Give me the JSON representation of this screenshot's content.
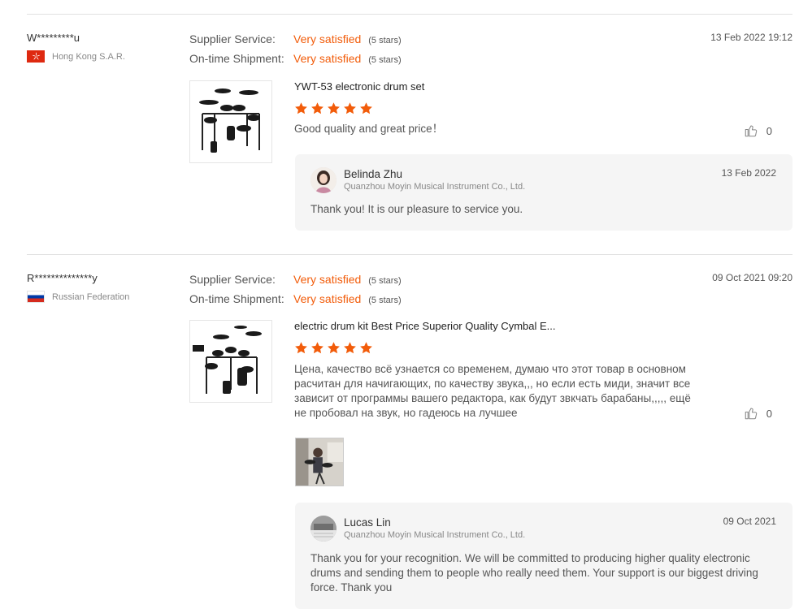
{
  "colors": {
    "accent": "#f25c0a",
    "reply_bg": "#f5f5f5",
    "divider": "#e2e2e2"
  },
  "reviews": [
    {
      "reviewer_name": "W*********u",
      "reviewer_country": "Hong Kong S.A.R.",
      "flag_icon": "hong-kong-flag-icon",
      "supplier_service_label": "Supplier Service:",
      "supplier_service_value": "Very satisfied",
      "supplier_service_stars": "(5 stars)",
      "shipment_label": "On-time Shipment:",
      "shipment_value": "Very satisfied",
      "shipment_stars": "(5 stars)",
      "date": "13 Feb 2022 19:12",
      "product_title": "YWT-53 electronic drum set",
      "rating": 5,
      "text": "Good quality and great price！",
      "likes": "0",
      "reply": {
        "name": "Belinda Zhu",
        "company": "Quanzhou Moyin Musical Instrument Co., Ltd.",
        "date": "13 Feb 2022",
        "text": "Thank you!  It is our pleasure to service you."
      }
    },
    {
      "reviewer_name": "R**************y",
      "reviewer_country": "Russian Federation",
      "flag_icon": "russia-flag-icon",
      "supplier_service_label": "Supplier Service:",
      "supplier_service_value": "Very satisfied",
      "supplier_service_stars": "(5 stars)",
      "shipment_label": "On-time Shipment:",
      "shipment_value": "Very satisfied",
      "shipment_stars": "(5 stars)",
      "date": "09 Oct 2021 09:20",
      "product_title": "electric drum kit Best Price Superior Quality Cymbal E...",
      "rating": 5,
      "text": "Цена, качество всё узнается со временем, думаю что этот товар в основном расчитан для начигающих, по качеству звука,,, но если есть миди, значит все зависит от программы вашего редактора, как будут звкчать  барабаны,,,,, ещё не пробовал на звук, но гадеюсь на лучшее",
      "likes": "0",
      "reply": {
        "name": "Lucas Lin",
        "company": "Quanzhou Moyin Musical Instrument Co., Ltd.",
        "date": "09 Oct 2021",
        "text": "Thank you for your recognition. We will be committed to producing higher quality electronic drums and sending them to people who really need them. Your support is our biggest driving force. Thank you"
      }
    }
  ]
}
